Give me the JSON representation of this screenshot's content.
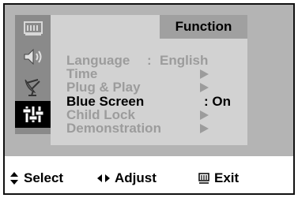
{
  "menu": {
    "header": "Function",
    "items": [
      {
        "label": "Language",
        "separator": ":",
        "value": "English",
        "state": "dim"
      },
      {
        "label": "Time",
        "state": "dim",
        "has_arrow": true
      },
      {
        "label": "Plug & Play",
        "state": "dim",
        "has_arrow": true
      },
      {
        "label": "Blue Screen",
        "separator": ":",
        "value": "On",
        "state": "selected"
      },
      {
        "label": "Child Lock",
        "state": "dim",
        "has_arrow": true
      },
      {
        "label": "Demonstration",
        "state": "dim",
        "has_arrow": true
      }
    ]
  },
  "sidebar": {
    "icons": [
      {
        "name": "picture-icon",
        "active": false
      },
      {
        "name": "speaker-icon",
        "active": false
      },
      {
        "name": "antenna-icon",
        "active": false
      },
      {
        "name": "function-sliders-icon",
        "active": true
      }
    ]
  },
  "footer": {
    "select_label": "Select",
    "adjust_label": "Adjust",
    "exit_label": "Exit"
  },
  "colors": {
    "panel": "#b4b4b4",
    "icon_column": "#8a8a8a",
    "content": "#d2d2d2",
    "header": "#a0a0a0",
    "dim_text": "#9c9c9c",
    "selected_text": "#000000"
  }
}
